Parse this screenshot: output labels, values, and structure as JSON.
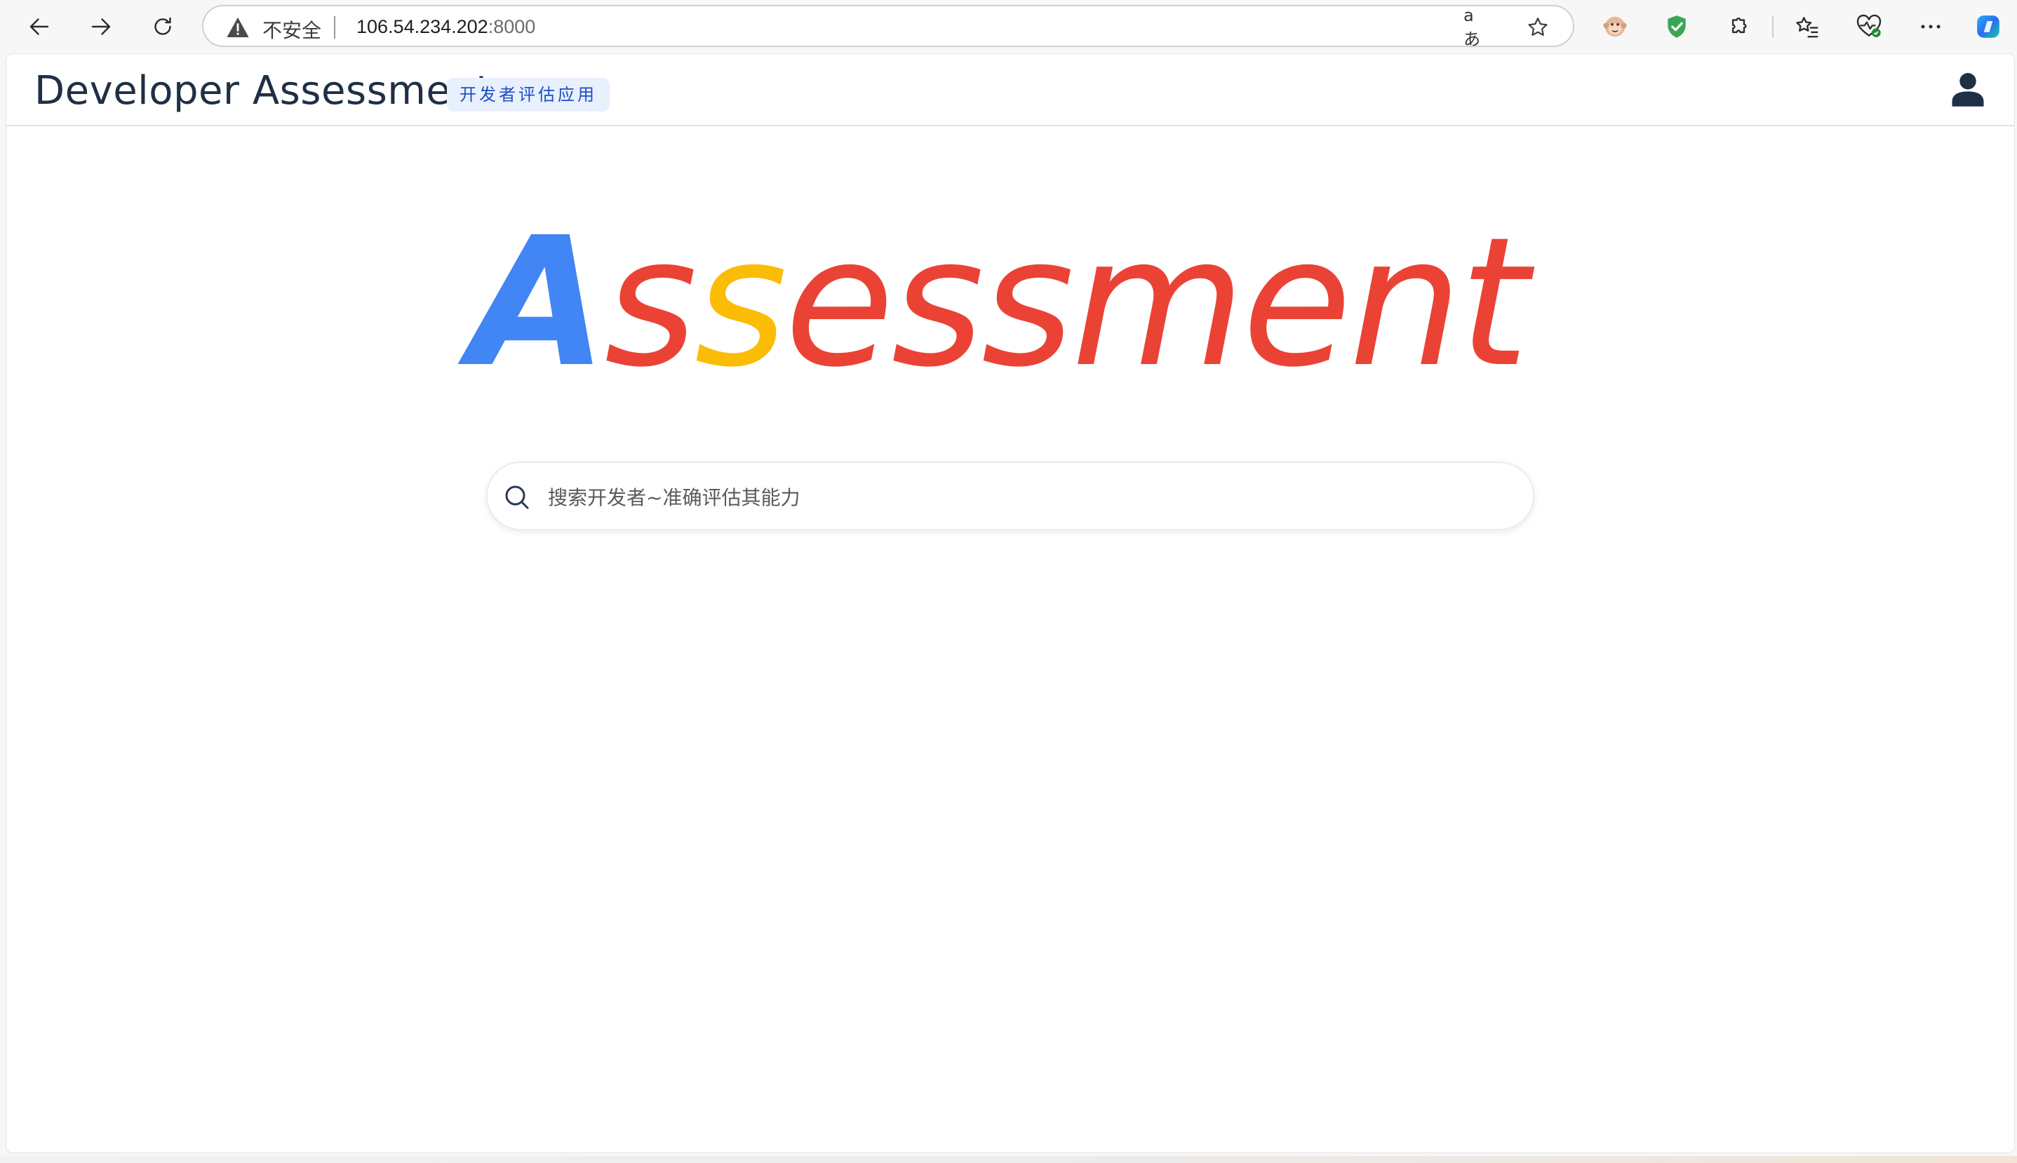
{
  "browser": {
    "insecure_label": "不安全",
    "url_host": "106.54.234.202",
    "url_port": ":8000",
    "translate_glyph": "aあ",
    "icons": {
      "back": "arrow-left-icon",
      "forward": "arrow-right-icon",
      "reload": "reload-icon",
      "warning": "warning-triangle-icon",
      "translate": "translate-icon",
      "favorite": "star-icon",
      "extension_monkey": "monkey-extension-icon",
      "extension_shield": "shield-check-icon",
      "extensions": "puzzle-icon",
      "favorites": "favorites-list-icon",
      "health": "heart-pulse-icon",
      "more": "more-dots-icon",
      "copilot": "copilot-icon"
    }
  },
  "header": {
    "title": "Developer Assessment",
    "tag": "开发者评估应用",
    "user_icon": "user-icon"
  },
  "hero": {
    "logo_parts": [
      "A",
      "s",
      "s",
      "essment"
    ],
    "logo_colors": [
      "#4285f4",
      "#ea4335",
      "#fbbc05",
      "#ea4335"
    ]
  },
  "search": {
    "placeholder": "搜索开发者~准确评估其能力",
    "value": "",
    "icon": "search-icon"
  }
}
